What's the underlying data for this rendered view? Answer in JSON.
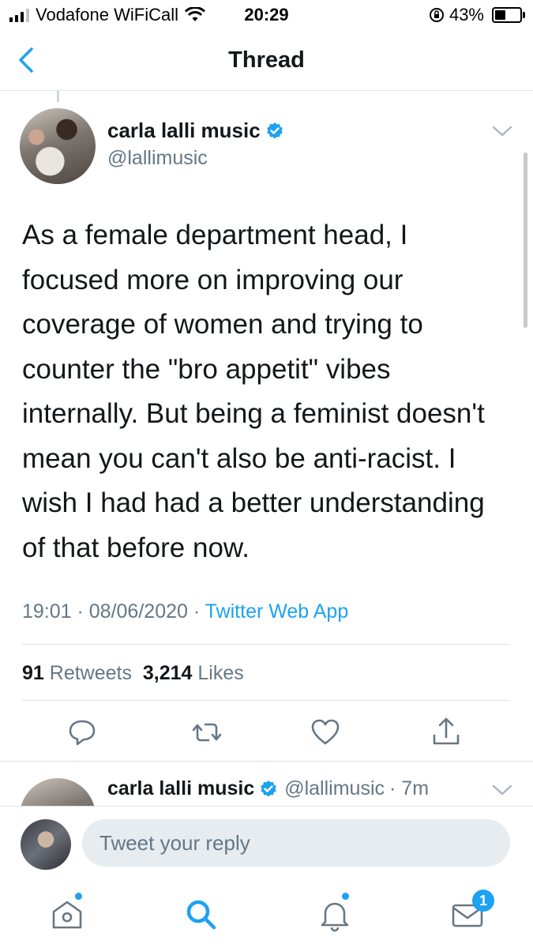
{
  "status_bar": {
    "carrier": "Vodafone WiFiCall",
    "time": "20:29",
    "battery": "43%",
    "battery_level": 0.43
  },
  "nav": {
    "title": "Thread"
  },
  "main_tweet": {
    "display_name": "carla lalli music",
    "handle": "@lallimusic",
    "text": "As a female department head, I focused more on improving our coverage of women and trying to counter the \"bro appetit\" vibes internally. But being a feminist doesn't mean you can't also be anti-racist. I wish I had had a better understanding of that before now.",
    "timestamp": "19:01 · 08/06/2020 · ",
    "source": "Twitter Web App",
    "retweet_count": "91",
    "retweet_label": "Retweets",
    "like_count": "3,214",
    "like_label": "Likes"
  },
  "second_tweet": {
    "display_name": "carla lalli music",
    "handle": "@lallimusic",
    "age": "· 7m"
  },
  "composer": {
    "placeholder": "Tweet your reply"
  },
  "tabbar": {
    "messages_badge": "1"
  },
  "colors": {
    "accent": "#1da1f2",
    "text": "#14171a",
    "muted": "#657786"
  }
}
